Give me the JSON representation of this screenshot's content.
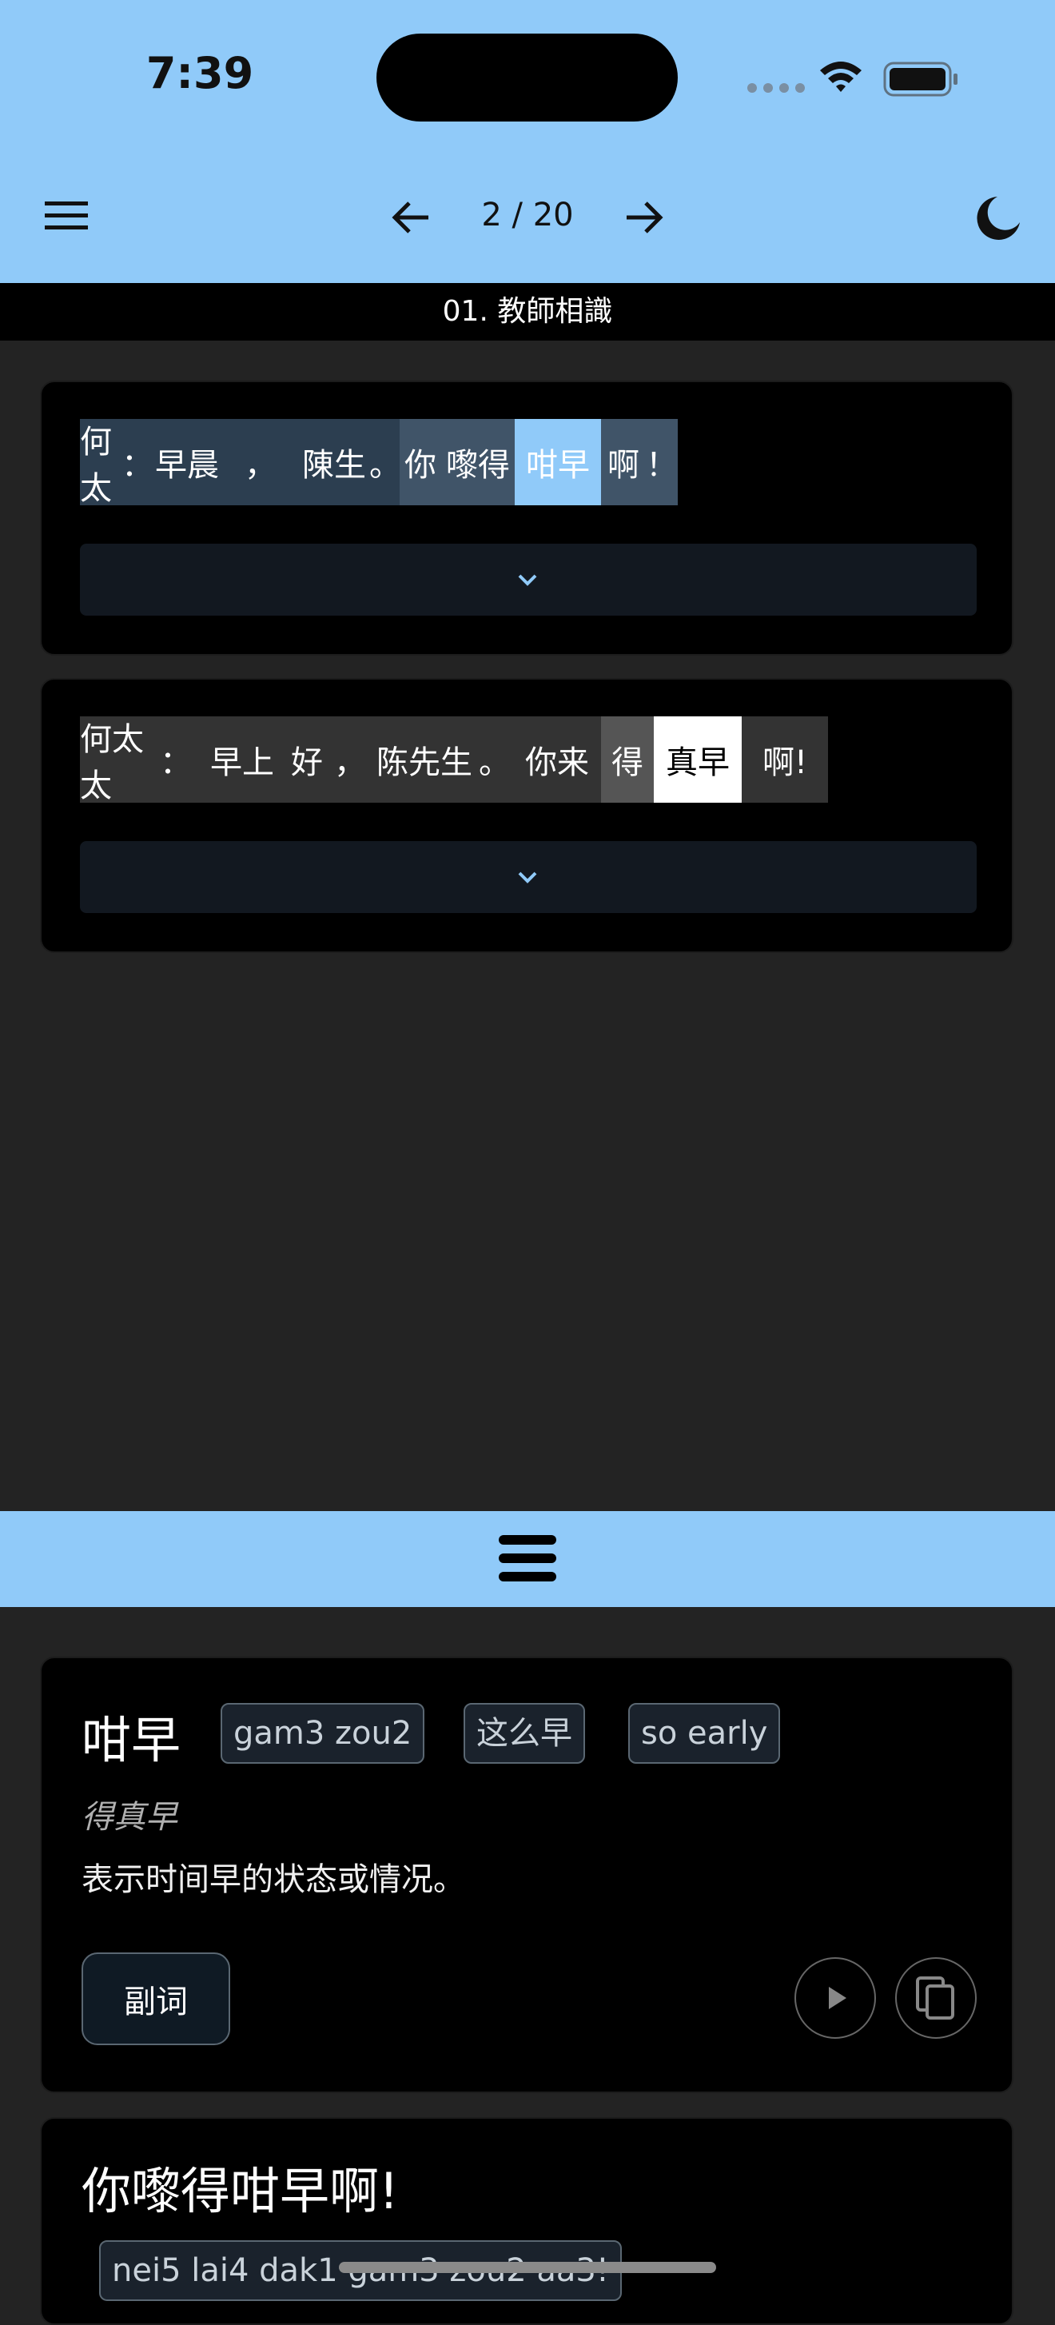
{
  "status_bar": {
    "time": "7:39"
  },
  "app_bar": {
    "page_counter": "2 / 20",
    "icons": [
      "menu-icon",
      "arrow-left-icon",
      "arrow-right-icon",
      "moon-icon"
    ]
  },
  "lesson": {
    "title": "01. 教師相識"
  },
  "sentences": [
    {
      "tokens": [
        {
          "text": "何太",
          "bg": "#2c3e50"
        },
        {
          "text": "：",
          "bg": "#2c3e50"
        },
        {
          "text": "早晨",
          "bg": "#2c3e50"
        },
        {
          "text": "，",
          "bg": "#2c3e50"
        },
        {
          "text": "陳生",
          "bg": "#2c3e50"
        },
        {
          "text": "。",
          "bg": "#2c3e50"
        },
        {
          "text": "你",
          "bg": "#405468"
        },
        {
          "text": "嚟得",
          "bg": "#405468"
        },
        {
          "text": "咁早",
          "bg": "#90caf9"
        },
        {
          "text": "啊",
          "bg": "#405468"
        },
        {
          "text": "！",
          "bg": "#405468"
        }
      ]
    },
    {
      "tokens": [
        {
          "text": "何太太",
          "bg": "#333333"
        },
        {
          "text": "：",
          "bg": "#333333"
        },
        {
          "text": "早上",
          "bg": "#333333"
        },
        {
          "text": "好",
          "bg": "#333333"
        },
        {
          "text": "，",
          "bg": "#333333"
        },
        {
          "text": "陈先生",
          "bg": "#333333"
        },
        {
          "text": "。",
          "bg": "#333333"
        },
        {
          "text": "你来",
          "bg": "#333333"
        },
        {
          "text": "得",
          "bg": "#555555"
        },
        {
          "text": "真早",
          "bg": "#ffffff"
        },
        {
          "text": "啊!",
          "bg": "#333333"
        }
      ]
    }
  ],
  "word": {
    "headword": "咁早",
    "jyutping": "gam3 zou2",
    "mandarin": "这么早",
    "english": "so early",
    "alt": "得真早",
    "definition": "表示时间早的状态或情况。",
    "pos": "副词"
  },
  "example": {
    "sentence": "你嚟得咁早啊!",
    "romanization": "nei5 lai4 dak1 gam3 zou2 aa3!"
  },
  "colors": {
    "accent": "#90caf9",
    "background": "#232323",
    "card": "#000000"
  }
}
